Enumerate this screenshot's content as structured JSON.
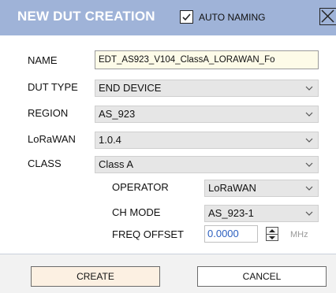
{
  "title": "NEW DUT CREATION",
  "auto_naming": {
    "label": "AUTO NAMING",
    "checked": true
  },
  "close": {
    "icon": "close-x-icon"
  },
  "fields": {
    "name": {
      "label": "NAME",
      "value": "EDT_AS923_V104_ClassA_LORAWAN_Fo"
    },
    "dut_type": {
      "label": "DUT TYPE",
      "value": "END DEVICE"
    },
    "region": {
      "label": "REGION",
      "value": "AS_923"
    },
    "lorawan": {
      "label": "LoRaWAN",
      "value": "1.0.4"
    },
    "class": {
      "label": "CLASS",
      "value": "Class A"
    },
    "operator": {
      "label": "OPERATOR",
      "value": "LoRaWAN"
    },
    "ch_mode": {
      "label": "CH MODE",
      "value": "AS_923-1"
    },
    "freq_offset": {
      "label": "FREQ OFFSET",
      "value": "0.0000",
      "unit": "MHz"
    }
  },
  "buttons": {
    "create": "CREATE",
    "cancel": "CANCEL"
  },
  "colors": {
    "titlebar": "#9fb3d8",
    "field_bg": "#e6e6e6",
    "name_bg": "#fdfbe8",
    "create_bg": "#fcf0e2",
    "value_blue": "#2b5fbf"
  }
}
